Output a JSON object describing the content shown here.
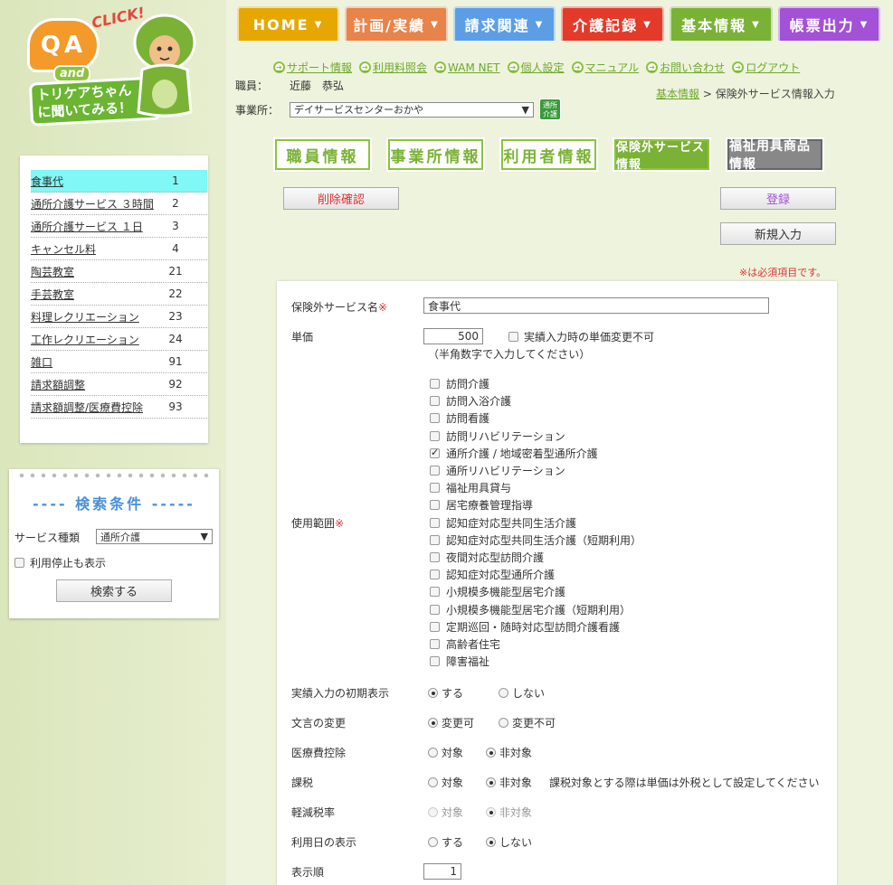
{
  "logo": {
    "q": "Q",
    "a": "A",
    "and": "and",
    "click": "CLICK!",
    "line1": "トリケアちゃん",
    "line2": "に聞いてみる！"
  },
  "nav": [
    {
      "label": "HOME",
      "color": "#e6a800"
    },
    {
      "label": "計画/実績",
      "color": "#e8834a"
    },
    {
      "label": "請求関連",
      "color": "#5b9ee6"
    },
    {
      "label": "介護記録",
      "color": "#e33a2a"
    },
    {
      "label": "基本情報",
      "color": "#7ab236"
    },
    {
      "label": "帳票出力",
      "color": "#a351d6"
    }
  ],
  "links": [
    "サポート情報",
    "利用料照会",
    "WAM NET",
    "個人設定",
    "マニュアル",
    "お問い合わせ",
    "ログアウト"
  ],
  "staff": {
    "label": "職員：",
    "name": "近藤　恭弘"
  },
  "office": {
    "label": "事業所：",
    "value": "デイサービスセンターおかや",
    "badge_line1": "通所",
    "badge_line2": "介護"
  },
  "breadcrumb": {
    "link": "基本情報",
    "sep": ">",
    "current": "保険外サービス情報入力"
  },
  "subtabs": [
    "職員情報",
    "事業所情報",
    "利用者情報",
    "保険外サービス情報",
    "福祉用具商品情報"
  ],
  "buttons": {
    "delete_confirm": "削除確認",
    "register": "登録",
    "new_entry": "新規入力",
    "search": "検索する"
  },
  "required_note": "※は必須項目です。",
  "form": {
    "service_name_label": "保険外サービス名",
    "required_mark": "※",
    "service_name_value": "食事代",
    "unit_price_label": "単価",
    "unit_price_value": "500",
    "unit_price_lock_label": "実績入力時の単価変更不可",
    "unit_price_hint": "（半角数字で入力してください）",
    "usage_label": "使用範囲",
    "usage_items": [
      {
        "label": "訪問介護",
        "checked": false
      },
      {
        "label": "訪問入浴介護",
        "checked": false
      },
      {
        "label": "訪問看護",
        "checked": false
      },
      {
        "label": "訪問リハビリテーション",
        "checked": false
      },
      {
        "label": "通所介護 / 地域密着型通所介護",
        "checked": true
      },
      {
        "label": "通所リハビリテーション",
        "checked": false
      },
      {
        "label": "福祉用具貸与",
        "checked": false
      },
      {
        "label": "居宅療養管理指導",
        "checked": false
      },
      {
        "label": "認知症対応型共同生活介護",
        "checked": false
      },
      {
        "label": "認知症対応型共同生活介護（短期利用）",
        "checked": false
      },
      {
        "label": "夜間対応型訪問介護",
        "checked": false
      },
      {
        "label": "認知症対応型通所介護",
        "checked": false
      },
      {
        "label": "小規模多機能型居宅介護",
        "checked": false
      },
      {
        "label": "小規模多機能型居宅介護（短期利用）",
        "checked": false
      },
      {
        "label": "定期巡回・随時対応型訪問介護看護",
        "checked": false
      },
      {
        "label": "高齢者住宅",
        "checked": false
      },
      {
        "label": "障害福祉",
        "checked": false
      }
    ],
    "initial_display": {
      "label": "実績入力の初期表示",
      "opt1": "する",
      "opt2": "しない"
    },
    "wording_change": {
      "label": "文言の変更",
      "opt1": "変更可",
      "opt2": "変更不可"
    },
    "medical_deduction": {
      "label": "医療費控除",
      "opt1": "対象",
      "opt2": "非対象"
    },
    "taxation": {
      "label": "課税",
      "opt1": "対象",
      "opt2": "非対象",
      "note": "課税対象とする際は単価は外税として設定してください"
    },
    "reduced_tax": {
      "label": "軽減税率",
      "opt1": "対象",
      "opt2": "非対象"
    },
    "use_date": {
      "label": "利用日の表示",
      "opt1": "する",
      "opt2": "しない"
    },
    "display_order": {
      "label": "表示順",
      "value": "1"
    }
  },
  "service_list": [
    {
      "name": "食事代",
      "num": "1",
      "selected": true
    },
    {
      "name": "通所介護サービス ３時間",
      "num": "2"
    },
    {
      "name": "通所介護サービス １日",
      "num": "3"
    },
    {
      "name": "キャンセル料",
      "num": "4"
    },
    {
      "name": "陶芸教室",
      "num": "21"
    },
    {
      "name": "手芸教室",
      "num": "22"
    },
    {
      "name": "料理レクリエーション",
      "num": "23"
    },
    {
      "name": "工作レクリエーション",
      "num": "24"
    },
    {
      "name": "雑口",
      "num": "91"
    },
    {
      "name": "請求額調整",
      "num": "92"
    },
    {
      "name": "請求額調整/医療費控除",
      "num": "93"
    }
  ],
  "search": {
    "title": "---- 検索条件 -----",
    "service_type_label": "サービス種類",
    "service_type_value": "通所介護",
    "show_stopped_label": "利用停止も表示"
  }
}
